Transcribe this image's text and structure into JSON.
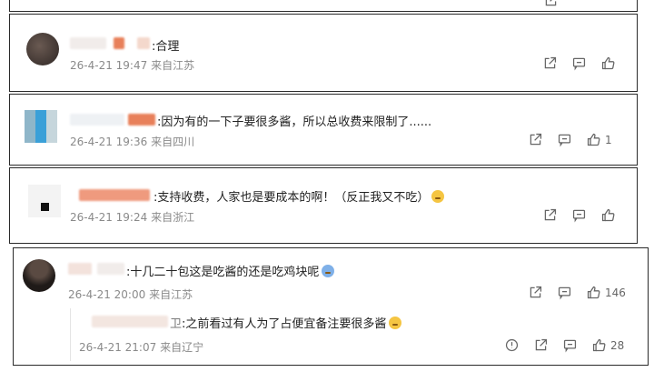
{
  "comments": [
    {
      "text": ":合理",
      "time": "26-4-21 19:47",
      "location": "来自江苏",
      "likes": ""
    },
    {
      "text": ":因为有的一下子要很多酱，所以总收费来限制了......",
      "time": "26-4-21 19:36",
      "location": "来自四川",
      "likes": "1"
    },
    {
      "text": ":支持收费，人家也是要成本的啊！（反正我又不吃）",
      "time": "26-4-21 19:24",
      "location": "来自浙江",
      "likes": ""
    },
    {
      "text": ":十几二十包这是吃酱的还是吃鸡块呢",
      "time": "26-4-21 20:00",
      "location": "来自江苏",
      "likes": "146"
    }
  ],
  "reply": {
    "name_tail": "卫",
    "text": ":之前看过有人为了占便宜备注要很多酱",
    "time": "26-4-21 21:07",
    "location": "来自辽宁",
    "likes": "28"
  },
  "icons": {
    "share": "share-icon",
    "comment": "comment-icon",
    "like": "thumbs-up-icon",
    "report": "report-icon"
  },
  "colors": {
    "meta": "#8a8a8a",
    "censor_orange": "#e8805a",
    "border": "#2a2a2a"
  }
}
